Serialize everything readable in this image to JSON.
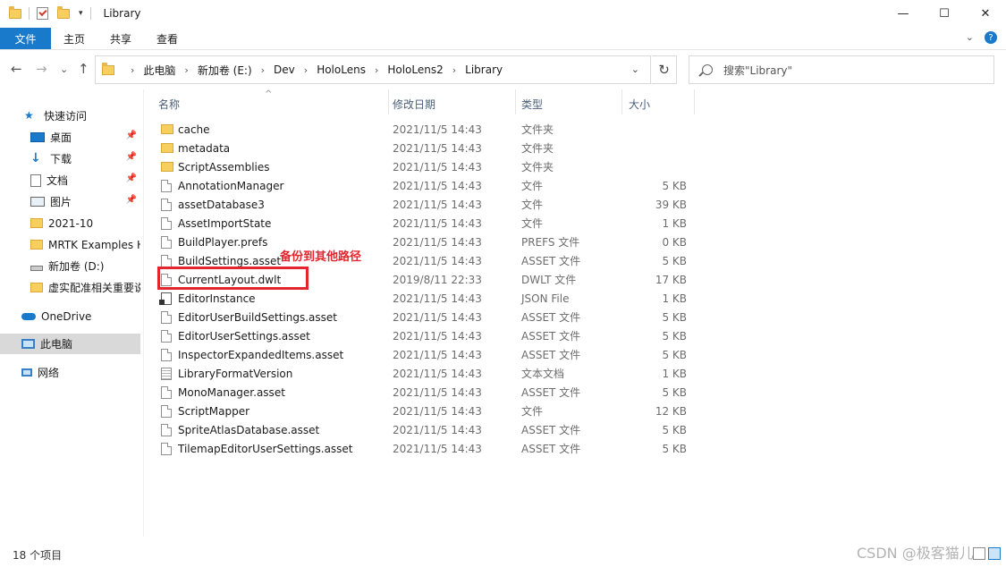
{
  "window": {
    "title": "Library",
    "minimize_glyph": "—",
    "maximize_glyph": "☐",
    "close_glyph": "✕"
  },
  "ribbon": {
    "tabs": [
      "文件",
      "主页",
      "共享",
      "查看"
    ],
    "collapse_glyph": "⌄",
    "help_glyph": "?"
  },
  "address": {
    "back_glyph": "←",
    "forward_glyph": "→",
    "recent_glyph": "⌄",
    "up_glyph": "↑",
    "crumbs": [
      "此电脑",
      "新加卷 (E:)",
      "Dev",
      "HoloLens",
      "HoloLens2",
      "Library"
    ],
    "separator": "›",
    "dropdown_glyph": "⌄",
    "refresh_glyph": "↻",
    "search_placeholder": "搜索\"Library\""
  },
  "nav": {
    "quick_access": "快速访问",
    "items": [
      {
        "label": "桌面",
        "icon": "desktop-icon",
        "pinned": true
      },
      {
        "label": "下载",
        "icon": "download-icon",
        "pinned": true
      },
      {
        "label": "文档",
        "icon": "document-icon",
        "pinned": true
      },
      {
        "label": "图片",
        "icon": "pictures-icon",
        "pinned": true
      },
      {
        "label": "2021-10",
        "icon": "folder-icon",
        "pinned": false
      },
      {
        "label": "MRTK Examples H",
        "icon": "folder-icon",
        "pinned": false
      },
      {
        "label": "新加卷 (D:)",
        "icon": "drive-icon",
        "pinned": false
      },
      {
        "label": "虚实配准相关重要说",
        "icon": "folder-icon",
        "pinned": false
      }
    ],
    "pin_glyph": "📌",
    "onedrive": "OneDrive",
    "this_pc": "此电脑",
    "network": "网络"
  },
  "columns": {
    "name": "名称",
    "date": "修改日期",
    "type": "类型",
    "size": "大小",
    "sort_glyph": "^"
  },
  "files": [
    {
      "name": "cache",
      "date": "2021/11/5 14:43",
      "type": "文件夹",
      "size": "",
      "kind": "folder"
    },
    {
      "name": "metadata",
      "date": "2021/11/5 14:43",
      "type": "文件夹",
      "size": "",
      "kind": "folder"
    },
    {
      "name": "ScriptAssemblies",
      "date": "2021/11/5 14:43",
      "type": "文件夹",
      "size": "",
      "kind": "folder"
    },
    {
      "name": "AnnotationManager",
      "date": "2021/11/5 14:43",
      "type": "文件",
      "size": "5 KB",
      "kind": "file"
    },
    {
      "name": "assetDatabase3",
      "date": "2021/11/5 14:43",
      "type": "文件",
      "size": "39 KB",
      "kind": "file"
    },
    {
      "name": "AssetImportState",
      "date": "2021/11/5 14:43",
      "type": "文件",
      "size": "1 KB",
      "kind": "file"
    },
    {
      "name": "BuildPlayer.prefs",
      "date": "2021/11/5 14:43",
      "type": "PREFS 文件",
      "size": "0 KB",
      "kind": "file"
    },
    {
      "name": "BuildSettings.asset",
      "date": "2021/11/5 14:43",
      "type": "ASSET 文件",
      "size": "5 KB",
      "kind": "file"
    },
    {
      "name": "CurrentLayout.dwlt",
      "date": "2019/8/11 22:33",
      "type": "DWLT 文件",
      "size": "17 KB",
      "kind": "file"
    },
    {
      "name": "EditorInstance",
      "date": "2021/11/5 14:43",
      "type": "JSON File",
      "size": "1 KB",
      "kind": "exe"
    },
    {
      "name": "EditorUserBuildSettings.asset",
      "date": "2021/11/5 14:43",
      "type": "ASSET 文件",
      "size": "5 KB",
      "kind": "file"
    },
    {
      "name": "EditorUserSettings.asset",
      "date": "2021/11/5 14:43",
      "type": "ASSET 文件",
      "size": "5 KB",
      "kind": "file"
    },
    {
      "name": "InspectorExpandedItems.asset",
      "date": "2021/11/5 14:43",
      "type": "ASSET 文件",
      "size": "5 KB",
      "kind": "file"
    },
    {
      "name": "LibraryFormatVersion",
      "date": "2021/11/5 14:43",
      "type": "文本文档",
      "size": "1 KB",
      "kind": "text"
    },
    {
      "name": "MonoManager.asset",
      "date": "2021/11/5 14:43",
      "type": "ASSET 文件",
      "size": "5 KB",
      "kind": "file"
    },
    {
      "name": "ScriptMapper",
      "date": "2021/11/5 14:43",
      "type": "文件",
      "size": "12 KB",
      "kind": "file"
    },
    {
      "name": "SpriteAtlasDatabase.asset",
      "date": "2021/11/5 14:43",
      "type": "ASSET 文件",
      "size": "5 KB",
      "kind": "file"
    },
    {
      "name": "TilemapEditorUserSettings.asset",
      "date": "2021/11/5 14:43",
      "type": "ASSET 文件",
      "size": "5 KB",
      "kind": "file"
    }
  ],
  "annotation": {
    "text": "备份到其他路径",
    "color": "#e3262d"
  },
  "status": {
    "item_count": "18 个项目"
  },
  "watermark": "CSDN @极客猫儿",
  "colors": {
    "accent": "#1979ca",
    "folder": "#f7cf5e"
  }
}
